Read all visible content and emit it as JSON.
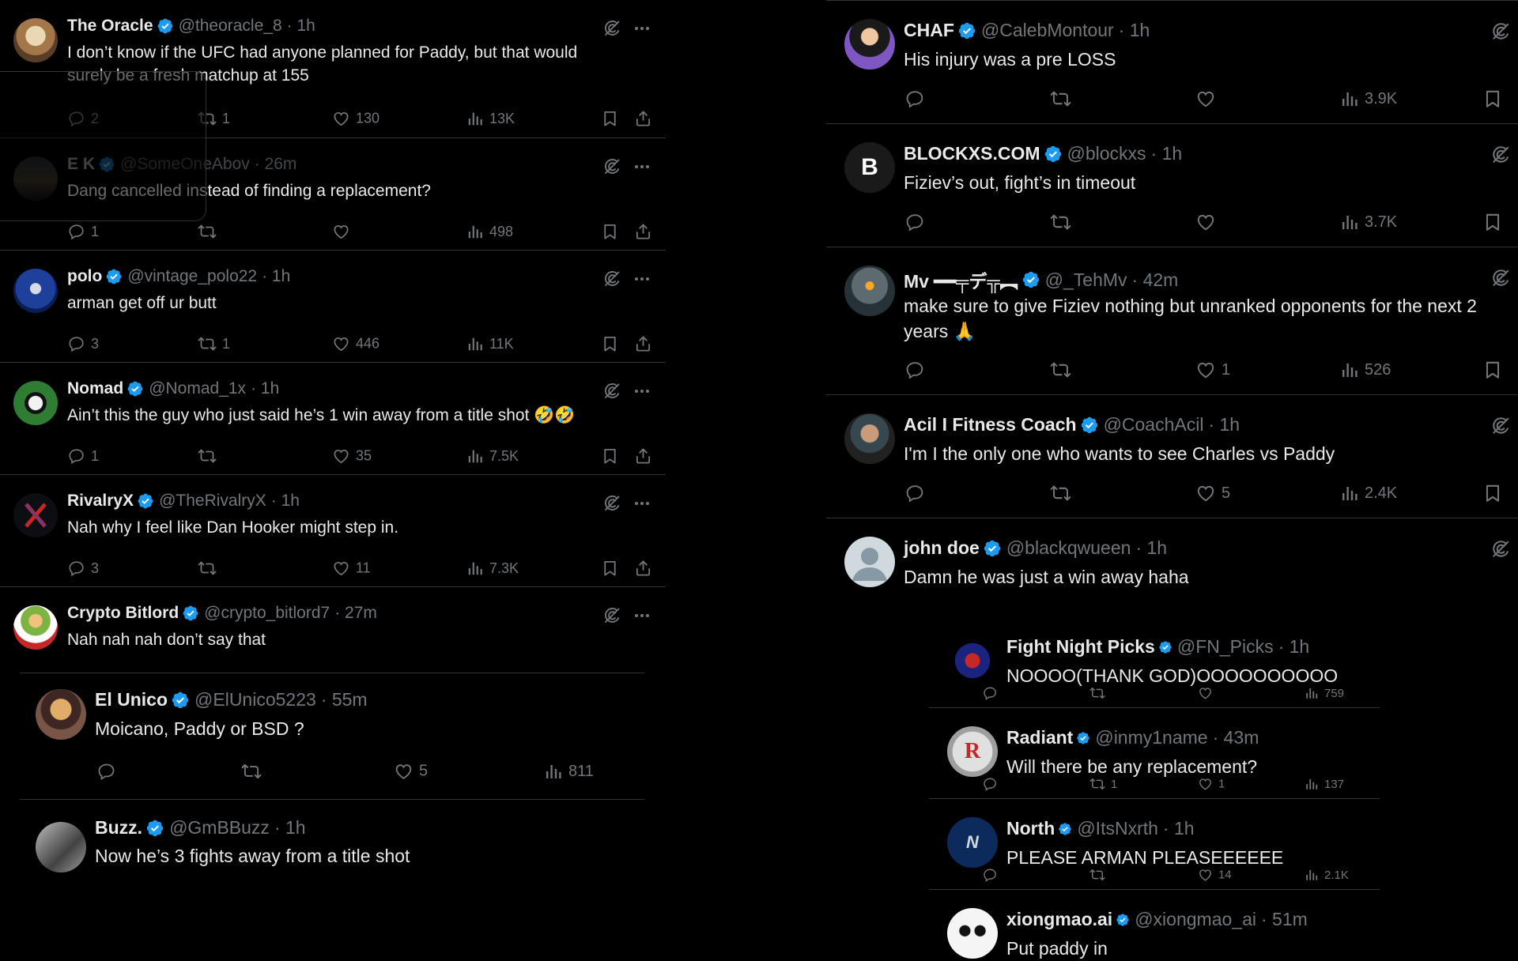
{
  "left": {
    "tweets": [
      {
        "name": "The Oracle",
        "handle": "@theoracle_8",
        "time": "· 1h",
        "text": "I don’t know if the UFC had anyone planned for Paddy, but that would surely be a fresh matchup at 155",
        "replies": "2",
        "retweets": "1",
        "likes": "130",
        "views": "13K"
      },
      {
        "name": "E K",
        "handle": "@SomeOneAbov",
        "time": "· 26m",
        "text": "Dang cancelled instead of finding a replacement?",
        "replies": "1",
        "retweets": "",
        "likes": "",
        "views": "498"
      },
      {
        "name": "polo",
        "handle": "@vintage_polo22",
        "time": "· 1h",
        "text": "arman get off ur butt",
        "replies": "3",
        "retweets": "1",
        "likes": "446",
        "views": "11K"
      },
      {
        "name": "Nomad",
        "handle": "@Nomad_1x",
        "time": "· 1h",
        "text": "Ain’t this the guy who just said he’s 1 win away from a title shot 🤣🤣",
        "replies": "1",
        "retweets": "",
        "likes": "35",
        "views": "7.5K"
      },
      {
        "name": "RivalryX",
        "handle": "@TheRivalryX",
        "time": "· 1h",
        "text": "Nah why I feel like Dan Hooker might step in.",
        "replies": "3",
        "retweets": "",
        "likes": "11",
        "views": "7.3K"
      },
      {
        "name": "Crypto Bitlord",
        "handle": "@crypto_bitlord7",
        "time": "· 27m",
        "text": "Nah nah nah don’t say that"
      }
    ],
    "nested": [
      {
        "name": "El Unico",
        "handle": "@ElUnico5223",
        "time": "· 55m",
        "text": "Moicano, Paddy or BSD ?",
        "replies": "",
        "retweets": "",
        "likes": "5",
        "views": "811"
      },
      {
        "name": "Buzz.",
        "handle": "@GmBBuzz",
        "time": "· 1h",
        "text": "Now he’s 3 fights away from a title shot"
      }
    ]
  },
  "right": {
    "tweets": [
      {
        "name": "CHAF",
        "handle": "@CalebMontour",
        "time": "· 1h",
        "text": "His injury was a pre LOSS",
        "replies": "",
        "retweets": "",
        "likes": "",
        "views": "3.9K"
      },
      {
        "name": "BLOCKXS.COM",
        "handle": "@blockxs",
        "time": "· 1h",
        "text": "Fiziev’s out, fight’s in timeout",
        "avatar_letter": "B",
        "replies": "",
        "retweets": "",
        "likes": "",
        "views": "3.7K"
      },
      {
        "name": "Mv ━━╤デ╦︻",
        "handle": "@_TehMv",
        "time": "· 42m",
        "text": "make sure to give Fiziev nothing but unranked opponents for the next 2 years 🙏",
        "replies": "",
        "retweets": "",
        "likes": "1",
        "views": "526"
      },
      {
        "name": "Acil I Fitness Coach",
        "handle": "@CoachAcil",
        "time": "· 1h",
        "text": "I'm I the only one who wants to see Charles vs Paddy",
        "replies": "",
        "retweets": "",
        "likes": "5",
        "views": "2.4K"
      },
      {
        "name": "john doe",
        "handle": "@blackqwueen",
        "time": "· 1h",
        "text": "Damn he was just a win away haha"
      }
    ],
    "replies": [
      {
        "name": "Fight Night Picks",
        "handle": "@FN_Picks",
        "time": "· 1h",
        "text": "NOOOO(THANK GOD)OOOOOOOOOO",
        "replies": "",
        "retweets": "",
        "likes": "",
        "views": "759"
      },
      {
        "name": "Radiant",
        "handle": "@inmy1name",
        "time": "· 43m",
        "text": "Will there be any replacement?",
        "avatar_letter": "R",
        "replies": "",
        "retweets": "1",
        "likes": "1",
        "views": "137"
      },
      {
        "name": "North",
        "handle": "@ItsNxrth",
        "time": "· 1h",
        "text": "PLEASE ARMAN PLEASEEEEEE",
        "avatar_letter": "N",
        "replies": "",
        "retweets": "",
        "likes": "14",
        "views": "2.1K"
      },
      {
        "name": "xiongmao.ai",
        "handle": "@xiongmao_ai",
        "time": "· 51m",
        "text": "Put paddy in"
      }
    ]
  },
  "colors": {
    "background": "#000000",
    "text": "#e7e9ea",
    "muted": "#71767b",
    "verified": "#1d9bf0",
    "divider": "#2f3336"
  }
}
